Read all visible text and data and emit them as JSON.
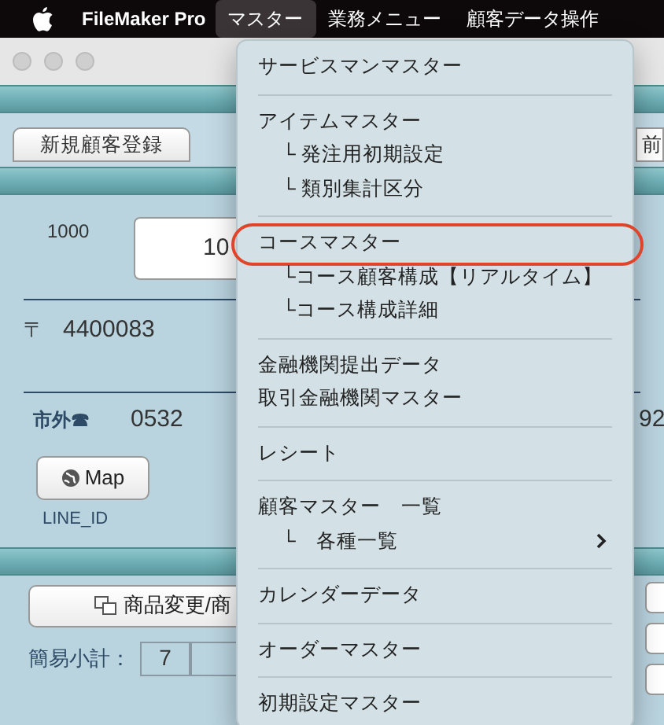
{
  "menu_bar": {
    "app_name": "FileMaker Pro",
    "menus": [
      {
        "label": "マスター",
        "selected": true
      },
      {
        "label": "業務メニュー",
        "selected": false
      },
      {
        "label": "顧客データ操作",
        "selected": false
      }
    ]
  },
  "window": {
    "tabs": [
      {
        "label": "新規顧客登録"
      },
      {
        "label": "前"
      }
    ],
    "customer_code_label": "1000",
    "customer_code_value": "10",
    "postal_mark": "〒",
    "postal_code": "4400083",
    "phone_label": "市外☎",
    "phone_area": "0532",
    "phone_rest": "92",
    "map_button": "Map",
    "line_id_label": "LINE_ID",
    "product_button": "商品変更/商",
    "subtotal_label": "簡易小計：",
    "subtotal_cells": [
      "7",
      ""
    ]
  },
  "dropdown": {
    "items": [
      {
        "kind": "item",
        "label": "サービスマンマスター",
        "circled": false
      },
      {
        "kind": "separator"
      },
      {
        "kind": "item",
        "label": "アイテムマスター",
        "circled": false
      },
      {
        "kind": "sub",
        "label": "└ 発注用初期設定",
        "circled": false
      },
      {
        "kind": "sub",
        "label": "└ 類別集計区分",
        "circled": false
      },
      {
        "kind": "separator"
      },
      {
        "kind": "item",
        "label": "コースマスター",
        "circled": true
      },
      {
        "kind": "sub",
        "label": "└コース顧客構成【リアルタイム】",
        "circled": false
      },
      {
        "kind": "sub",
        "label": "└コース構成詳細",
        "circled": false
      },
      {
        "kind": "separator"
      },
      {
        "kind": "item",
        "label": "金融機関提出データ",
        "circled": false
      },
      {
        "kind": "item",
        "label": "取引金融機関マスター",
        "circled": false
      },
      {
        "kind": "separator"
      },
      {
        "kind": "item",
        "label": "レシート",
        "circled": false
      },
      {
        "kind": "separator"
      },
      {
        "kind": "item",
        "label": "顧客マスター　一覧",
        "circled": false
      },
      {
        "kind": "sub",
        "label": "└　各種一覧",
        "circled": false,
        "submenu": true
      },
      {
        "kind": "separator"
      },
      {
        "kind": "item",
        "label": "カレンダーデータ",
        "circled": false
      },
      {
        "kind": "separator"
      },
      {
        "kind": "item",
        "label": "オーダーマスター",
        "circled": false
      },
      {
        "kind": "separator"
      },
      {
        "kind": "item",
        "label": "初期設定マスター",
        "circled": false
      }
    ]
  }
}
